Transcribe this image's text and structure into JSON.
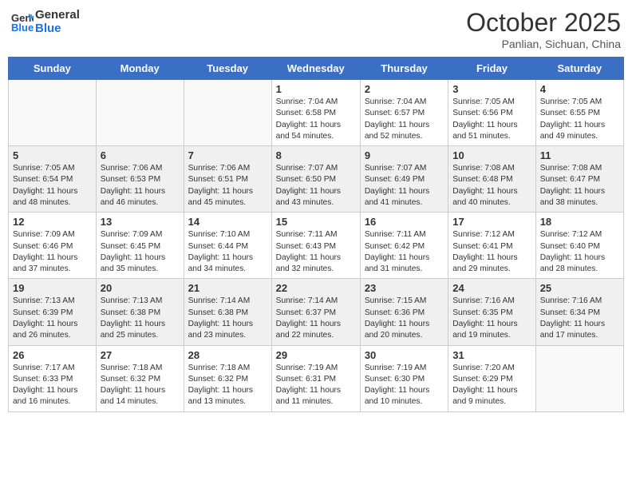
{
  "header": {
    "logo_line1": "General",
    "logo_line2": "Blue",
    "month": "October 2025",
    "location": "Panlian, Sichuan, China"
  },
  "days_of_week": [
    "Sunday",
    "Monday",
    "Tuesday",
    "Wednesday",
    "Thursday",
    "Friday",
    "Saturday"
  ],
  "weeks": [
    [
      {
        "day": "",
        "info": ""
      },
      {
        "day": "",
        "info": ""
      },
      {
        "day": "",
        "info": ""
      },
      {
        "day": "1",
        "info": "Sunrise: 7:04 AM\nSunset: 6:58 PM\nDaylight: 11 hours\nand 54 minutes."
      },
      {
        "day": "2",
        "info": "Sunrise: 7:04 AM\nSunset: 6:57 PM\nDaylight: 11 hours\nand 52 minutes."
      },
      {
        "day": "3",
        "info": "Sunrise: 7:05 AM\nSunset: 6:56 PM\nDaylight: 11 hours\nand 51 minutes."
      },
      {
        "day": "4",
        "info": "Sunrise: 7:05 AM\nSunset: 6:55 PM\nDaylight: 11 hours\nand 49 minutes."
      }
    ],
    [
      {
        "day": "5",
        "info": "Sunrise: 7:05 AM\nSunset: 6:54 PM\nDaylight: 11 hours\nand 48 minutes."
      },
      {
        "day": "6",
        "info": "Sunrise: 7:06 AM\nSunset: 6:53 PM\nDaylight: 11 hours\nand 46 minutes."
      },
      {
        "day": "7",
        "info": "Sunrise: 7:06 AM\nSunset: 6:51 PM\nDaylight: 11 hours\nand 45 minutes."
      },
      {
        "day": "8",
        "info": "Sunrise: 7:07 AM\nSunset: 6:50 PM\nDaylight: 11 hours\nand 43 minutes."
      },
      {
        "day": "9",
        "info": "Sunrise: 7:07 AM\nSunset: 6:49 PM\nDaylight: 11 hours\nand 41 minutes."
      },
      {
        "day": "10",
        "info": "Sunrise: 7:08 AM\nSunset: 6:48 PM\nDaylight: 11 hours\nand 40 minutes."
      },
      {
        "day": "11",
        "info": "Sunrise: 7:08 AM\nSunset: 6:47 PM\nDaylight: 11 hours\nand 38 minutes."
      }
    ],
    [
      {
        "day": "12",
        "info": "Sunrise: 7:09 AM\nSunset: 6:46 PM\nDaylight: 11 hours\nand 37 minutes."
      },
      {
        "day": "13",
        "info": "Sunrise: 7:09 AM\nSunset: 6:45 PM\nDaylight: 11 hours\nand 35 minutes."
      },
      {
        "day": "14",
        "info": "Sunrise: 7:10 AM\nSunset: 6:44 PM\nDaylight: 11 hours\nand 34 minutes."
      },
      {
        "day": "15",
        "info": "Sunrise: 7:11 AM\nSunset: 6:43 PM\nDaylight: 11 hours\nand 32 minutes."
      },
      {
        "day": "16",
        "info": "Sunrise: 7:11 AM\nSunset: 6:42 PM\nDaylight: 11 hours\nand 31 minutes."
      },
      {
        "day": "17",
        "info": "Sunrise: 7:12 AM\nSunset: 6:41 PM\nDaylight: 11 hours\nand 29 minutes."
      },
      {
        "day": "18",
        "info": "Sunrise: 7:12 AM\nSunset: 6:40 PM\nDaylight: 11 hours\nand 28 minutes."
      }
    ],
    [
      {
        "day": "19",
        "info": "Sunrise: 7:13 AM\nSunset: 6:39 PM\nDaylight: 11 hours\nand 26 minutes."
      },
      {
        "day": "20",
        "info": "Sunrise: 7:13 AM\nSunset: 6:38 PM\nDaylight: 11 hours\nand 25 minutes."
      },
      {
        "day": "21",
        "info": "Sunrise: 7:14 AM\nSunset: 6:38 PM\nDaylight: 11 hours\nand 23 minutes."
      },
      {
        "day": "22",
        "info": "Sunrise: 7:14 AM\nSunset: 6:37 PM\nDaylight: 11 hours\nand 22 minutes."
      },
      {
        "day": "23",
        "info": "Sunrise: 7:15 AM\nSunset: 6:36 PM\nDaylight: 11 hours\nand 20 minutes."
      },
      {
        "day": "24",
        "info": "Sunrise: 7:16 AM\nSunset: 6:35 PM\nDaylight: 11 hours\nand 19 minutes."
      },
      {
        "day": "25",
        "info": "Sunrise: 7:16 AM\nSunset: 6:34 PM\nDaylight: 11 hours\nand 17 minutes."
      }
    ],
    [
      {
        "day": "26",
        "info": "Sunrise: 7:17 AM\nSunset: 6:33 PM\nDaylight: 11 hours\nand 16 minutes."
      },
      {
        "day": "27",
        "info": "Sunrise: 7:18 AM\nSunset: 6:32 PM\nDaylight: 11 hours\nand 14 minutes."
      },
      {
        "day": "28",
        "info": "Sunrise: 7:18 AM\nSunset: 6:32 PM\nDaylight: 11 hours\nand 13 minutes."
      },
      {
        "day": "29",
        "info": "Sunrise: 7:19 AM\nSunset: 6:31 PM\nDaylight: 11 hours\nand 11 minutes."
      },
      {
        "day": "30",
        "info": "Sunrise: 7:19 AM\nSunset: 6:30 PM\nDaylight: 11 hours\nand 10 minutes."
      },
      {
        "day": "31",
        "info": "Sunrise: 7:20 AM\nSunset: 6:29 PM\nDaylight: 11 hours\nand 9 minutes."
      },
      {
        "day": "",
        "info": ""
      }
    ]
  ]
}
